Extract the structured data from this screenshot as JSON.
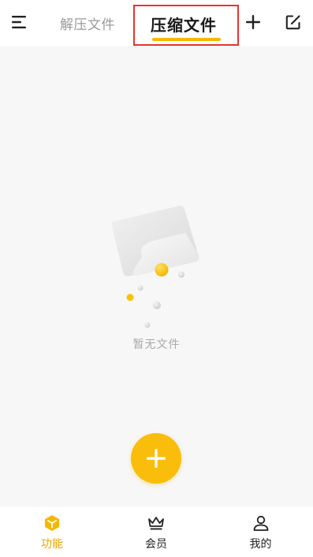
{
  "header": {
    "tabs": [
      {
        "label": "解压文件",
        "active": false
      },
      {
        "label": "压缩文件",
        "active": true
      }
    ],
    "menu_icon": "menu-icon",
    "add_icon": "plus-icon",
    "edit_icon": "edit-icon"
  },
  "main": {
    "empty_text": "暂无文件"
  },
  "fab": {
    "icon": "plus-icon"
  },
  "bottom_nav": {
    "items": [
      {
        "label": "功能",
        "icon": "cube-icon",
        "active": true
      },
      {
        "label": "会员",
        "icon": "crown-icon",
        "active": false
      },
      {
        "label": "我的",
        "icon": "user-icon",
        "active": false
      }
    ]
  },
  "colors": {
    "accent": "#fbbd0b",
    "active_nav": "#f0a500",
    "highlight_box": "#e8332e"
  }
}
